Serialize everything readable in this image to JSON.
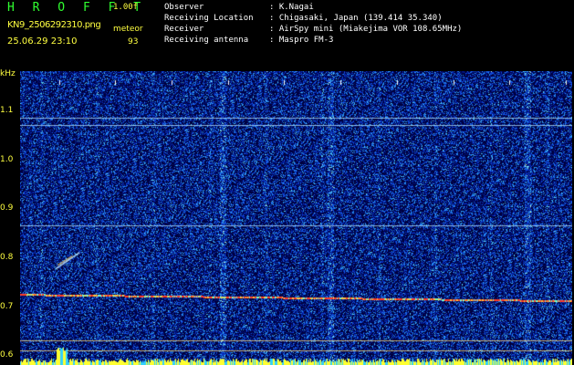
{
  "header": {
    "logo": "H R O F F T",
    "version": "1.00f",
    "filename": "KN9_2506292310.png",
    "meteor_label": "meteor",
    "meteor_count": "93",
    "datetime": "25.06.29 23:10",
    "observer": {
      "label": "Observer",
      "value": ": K.Nagai"
    },
    "location": {
      "label": "Receiving Location",
      "value": ": Chigasaki, Japan (139.414 35.340)"
    },
    "receiver": {
      "label": "Receiver",
      "value": ": AirSpy mini (Miakejima VOR 108.65MHz)"
    },
    "antenna": {
      "label": "Receiving antenna",
      "value": ": Maspro FM-3"
    }
  },
  "chart_data": {
    "type": "heatmap",
    "ylabel": "kHz",
    "y_ticks": [
      "1.1",
      "1.0",
      "0.9",
      "0.8",
      "0.7",
      "0.6"
    ],
    "x_ticks": [
      "2311",
      "2312",
      "2313",
      "2314",
      "2315",
      "2316",
      "2317",
      "2318",
      "2319",
      "2320"
    ],
    "ylim": [
      0.58,
      1.18
    ],
    "xlim": [
      2310.7,
      2320.5
    ],
    "horizontal_lines_khz": [
      1.085,
      1.07,
      0.865,
      0.63,
      0.61
    ],
    "carrier_khz_start": 0.725,
    "carrier_khz_end": 0.712,
    "meteor_echo": {
      "time": 2311.4,
      "khz": 0.795
    }
  }
}
